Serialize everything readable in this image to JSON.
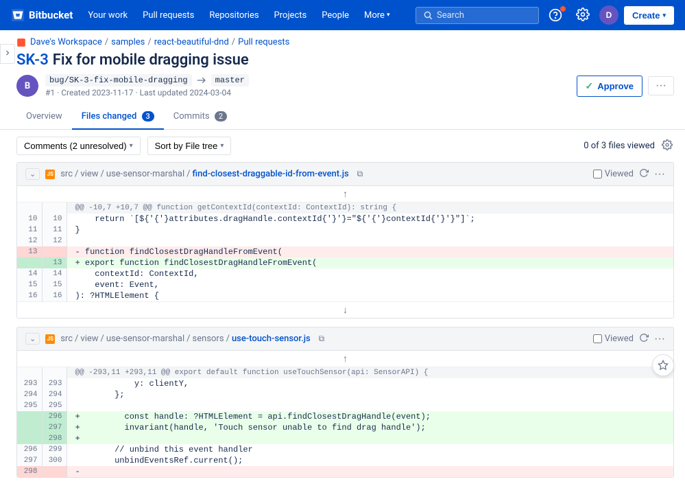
{
  "app": {
    "logo_text": "Bitbucket",
    "logo_icon": "bitbucket"
  },
  "topnav": {
    "links": [
      {
        "label": "Your work",
        "id": "your-work"
      },
      {
        "label": "Pull requests",
        "id": "pull-requests"
      },
      {
        "label": "Repositories",
        "id": "repositories"
      },
      {
        "label": "Projects",
        "id": "projects"
      },
      {
        "label": "People",
        "id": "people"
      },
      {
        "label": "More",
        "id": "more",
        "has_dropdown": true
      }
    ],
    "search_placeholder": "Search",
    "create_label": "Create"
  },
  "breadcrumb": {
    "items": [
      {
        "label": "Dave's Workspace",
        "id": "workspace"
      },
      {
        "label": "samples",
        "id": "samples"
      },
      {
        "label": "react-beautiful-dnd",
        "id": "repo"
      },
      {
        "label": "Pull requests",
        "id": "pull-requests"
      }
    ]
  },
  "pr": {
    "id": "SK-3",
    "title": "Fix for mobile dragging issue",
    "author_initials": "B",
    "source_branch": "bug/SK-3-fix-mobile-dragging",
    "target_branch": "master",
    "number": "#1",
    "created": "Created 2023-11-17",
    "updated": "Last updated 2024-03-04",
    "approve_label": "Approve",
    "more_label": "..."
  },
  "tabs": [
    {
      "label": "Overview",
      "id": "overview",
      "badge": null,
      "active": false
    },
    {
      "label": "Files changed",
      "id": "files-changed",
      "badge": "3",
      "active": true
    },
    {
      "label": "Commits",
      "id": "commits",
      "badge": "2",
      "active": false
    }
  ],
  "toolbar": {
    "comments_label": "Comments (2 unresolved)",
    "sort_label": "Sort by File tree",
    "files_viewed": "0 of 3 files viewed"
  },
  "files": [
    {
      "id": "file1",
      "icon_color": "#ff8b00",
      "path_segments": [
        "src",
        "view",
        "use-sensor-marshal"
      ],
      "filename": "find-closest-draggable-id-from-event.js",
      "hunk_header": "@@ -10,7 +10,7 @@ function getContextId(contextId: ContextId): string {",
      "lines": [
        {
          "old_num": "10",
          "new_num": "10",
          "type": "context",
          "content": "    return `[${attributes.dragHandle.contextId}=\"${contextId}\"]`;"
        },
        {
          "old_num": "11",
          "new_num": "11",
          "type": "context",
          "content": "}"
        },
        {
          "old_num": "12",
          "new_num": "12",
          "type": "context",
          "content": ""
        },
        {
          "old_num": "13",
          "new_num": "",
          "type": "removed",
          "content": "- function findClosestDragHandleFromEvent("
        },
        {
          "old_num": "",
          "new_num": "13",
          "type": "added",
          "content": "+ export function findClosestDragHandleFromEvent("
        },
        {
          "old_num": "14",
          "new_num": "14",
          "type": "context",
          "content": "    contextId: ContextId,"
        },
        {
          "old_num": "15",
          "new_num": "15",
          "type": "context",
          "content": "    event: Event,"
        },
        {
          "old_num": "16",
          "new_num": "16",
          "type": "context",
          "content": "): ?HTMLElement {"
        }
      ]
    },
    {
      "id": "file2",
      "icon_color": "#ff8b00",
      "path_segments": [
        "src",
        "view",
        "use-sensor-marshal",
        "sensors"
      ],
      "filename": "use-touch-sensor.js",
      "hunk_header": "@@ -293,11 +293,11 @@ export default function useTouchSensor(api: SensorAPI) {",
      "lines": [
        {
          "old_num": "293",
          "new_num": "293",
          "type": "context",
          "content": "            y: clientY,"
        },
        {
          "old_num": "294",
          "new_num": "294",
          "type": "context",
          "content": "        };"
        },
        {
          "old_num": "295",
          "new_num": "295",
          "type": "context",
          "content": ""
        },
        {
          "old_num": "",
          "new_num": "296",
          "type": "added",
          "content": "+         const handle: ?HTMLElement = api.findClosestDragHandle(event);"
        },
        {
          "old_num": "",
          "new_num": "297",
          "type": "added",
          "content": "+         invariant(handle, 'Touch sensor unable to find drag handle');"
        },
        {
          "old_num": "",
          "new_num": "298",
          "type": "added",
          "content": "+"
        },
        {
          "old_num": "296",
          "new_num": "299",
          "type": "context",
          "content": "        // unbind this event handler"
        },
        {
          "old_num": "297",
          "new_num": "300",
          "type": "context",
          "content": "        unbindEventsRef.current();"
        },
        {
          "old_num": "298",
          "new_num": "",
          "type": "removed",
          "content": "-"
        }
      ]
    }
  ]
}
